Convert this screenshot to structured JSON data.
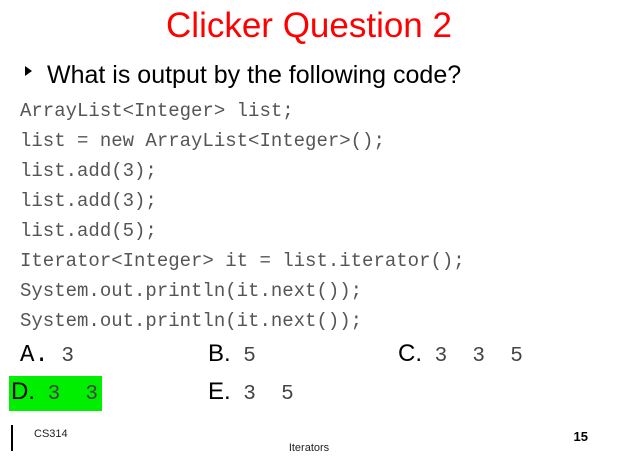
{
  "title": "Clicker Question 2",
  "question": "What is output by the following code?",
  "code_lines": [
    "ArrayList<Integer> list;",
    "list = new ArrayList<Integer>();",
    "list.add(3);",
    "list.add(3);",
    "list.add(5);",
    "Iterator<Integer> it = list.iterator();",
    "System.out.println(it.next());",
    "System.out.println(it.next());"
  ],
  "options": [
    {
      "letter": "A.",
      "value": "3"
    },
    {
      "letter": "B.",
      "value": "5"
    },
    {
      "letter": "C.",
      "value": "3 3 5"
    },
    {
      "letter": "D.",
      "value": "3 3"
    },
    {
      "letter": "E.",
      "value": "3 5"
    }
  ],
  "highlighted_option": "D",
  "footer": {
    "course": "CS314",
    "topic": "Iterators",
    "page_number": "15"
  },
  "colors": {
    "title": "#ff0000",
    "highlight": "#00ee00"
  }
}
